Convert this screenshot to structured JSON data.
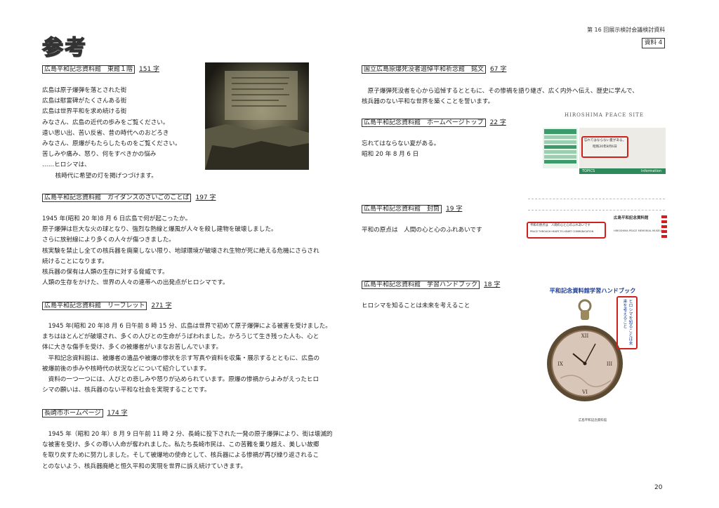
{
  "header": {
    "note": "第 16 回展示検討会議検討資料",
    "badge": "資料 4"
  },
  "title": "参考",
  "page_number": "20",
  "sections": {
    "s1": {
      "title": "広島平和記念資料館　東館１階",
      "count": "151 字",
      "lines": [
        "広島は原子爆弾を落とされた街",
        "広島は慰霊碑がたくさんある街",
        "広島は世界平和を求め続ける街",
        "みなさん、広島の近代の歩みをご覧ください。",
        "遠い思い出、苦い反省、昔の時代へのおどろき",
        "みなさん、原爆がもたらしたものをご覧ください。",
        "苦しみや痛み、怒り、何をすべきかの悩み",
        "……ヒロシマは、",
        "　核時代に希望の灯を掲げつづけます。"
      ]
    },
    "s2": {
      "title": "広島平和記念資料館　ガイダンスのさいごのことば",
      "count": "197 字",
      "lines": [
        "1945 年(昭和 20 年)8 月 6 日広島で何が起こったか。",
        "原子爆弾は巨大な火の球となり、強烈な熱線と爆風が人々を殺し建物を破壊しました。",
        "さらに放射線により多くの人々が傷つきました。",
        "核実験を禁止し全ての核兵器を廃棄しない限り、地球環境が破壊され生物が死に絶える危機にさらされ",
        "続けることになります。",
        "核兵器の保有は人類の生存に対する脅威です。",
        "人類の生存をかけた、世界の人々の連帯への出発点がヒロシマです。"
      ]
    },
    "s3": {
      "title": "広島平和記念資料館　リーフレット",
      "count": "271 字",
      "lines": [
        "　1945 年(昭和 20 年)8 月 6 日午前 8 時 15 分、広島は世界で初めて原子爆弾による被害を受けました。",
        "まちはほとんどが破壊され、多くの人びとの生命がうばわれました。かろうじて生き残った人も、心と",
        "体に大きな傷手を受け、多くの被爆者がいまなお苦しんでいます。",
        "　平和記念資料館は、被爆者の遺品や被爆の惨状を示す写真や資料を収集・展示するとともに、広島の",
        "被爆前後の歩みや核時代の状況などについて紹介しています。",
        "　資料の一つ一つには、人びとの悲しみや怒りが込められています。原爆の惨禍からよみがえったヒロ",
        "シマの願いは、核兵器のない平和な社会を実現することです。"
      ]
    },
    "s4": {
      "title": "長崎市ホームページ",
      "count": "174 字",
      "lines": [
        "　1945 年（昭和 20 年）8 月 9 日午前 11 時 2 分、長崎に投下された一発の原子爆弾により、街は壊滅的",
        "な被害を受け、多くの尊い人命が奪われました。私たち長崎市民は、この苦難を乗り越え、美しい故郷",
        "を取り戻すために努力しました。そして被爆地の使命として、核兵器による惨禍が再び繰り返されるこ",
        "とのないよう、核兵器廃絶と恒久平和の実現を世界に訴え続けていきます。"
      ]
    },
    "s5": {
      "title": "国立広島原爆死没者追悼平和祈念館　銘文",
      "count": "67 字",
      "lines": [
        "　原子爆弾死没者を心から追悼するとともに、その惨禍を語り継ぎ、広く内外へ伝え、歴史に学んで、",
        "核兵器のない平和な世界を築くことを誓います。"
      ]
    },
    "s6": {
      "title": "広島平和記念資料館　ホームページトップ",
      "count": "22 字",
      "lines": [
        "忘れてはならない夏がある。",
        "昭和 20 年 8 月 6 日"
      ]
    },
    "s7": {
      "title": "広島平和記念資料館　封筒",
      "count": "19 字",
      "lines": [
        "平和の原点は　人間の心と心のふれあいです"
      ]
    },
    "s8": {
      "title": "広島平和記念資料館　学習ハンドブック",
      "count": "18 字",
      "lines": [
        "ヒロシマを知ることは未来を考えること"
      ]
    }
  },
  "images": {
    "web": {
      "site_title": "HIROSHIMA PEACE SITE",
      "box_line1": "忘れてはならない夏がある。",
      "box_line2": "昭和20年8月6日",
      "bar_left": "TOPICS",
      "bar_right": "Information"
    },
    "envelope": {
      "museum": "広島平和記念資料館",
      "box_line1": "平和の原点は　人間の心と心のふれあいです",
      "box_line2": "PEACE THROUGH HEART-TO-HEART COMMUNICATION",
      "museum_en": "HIROSHIMA PEACE MEMORIAL MUSEUM"
    },
    "book": {
      "title": "平和記念資料館学習ハンドブック",
      "vertical": "ヒロシマを知ることは未来を考えること",
      "footer": "広島平和記念資料館"
    }
  },
  "colors": {
    "accent_red": "#d0201e",
    "book_title_blue": "#1d3f9a",
    "web_green": "#2e8a5a"
  }
}
